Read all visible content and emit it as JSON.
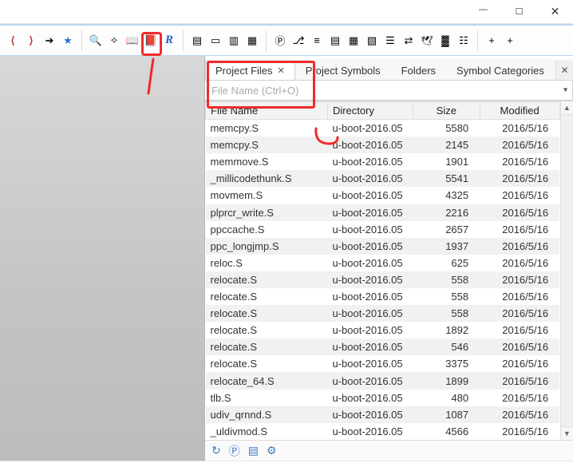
{
  "window": {
    "min": "—",
    "max": "☐",
    "close": "✕"
  },
  "tabs": {
    "project_files": "Project Files",
    "project_symbols": "Project Symbols",
    "folders": "Folders",
    "symbol_categories": "Symbol Categories"
  },
  "search": {
    "placeholder": "File Name (Ctrl+O)"
  },
  "columns": {
    "file_name": "File Name",
    "directory": "Directory",
    "size": "Size",
    "modified": "Modified"
  },
  "rows": [
    {
      "name": "memcpy.S",
      "dir": "u-boot-2016.05",
      "size": "5580",
      "mod": "2016/5/16"
    },
    {
      "name": "memcpy.S",
      "dir": "u-boot-2016.05",
      "size": "2145",
      "mod": "2016/5/16"
    },
    {
      "name": "memmove.S",
      "dir": "u-boot-2016.05",
      "size": "1901",
      "mod": "2016/5/16"
    },
    {
      "name": "_millicodethunk.S",
      "dir": "u-boot-2016.05",
      "size": "5541",
      "mod": "2016/5/16"
    },
    {
      "name": "movmem.S",
      "dir": "u-boot-2016.05",
      "size": "4325",
      "mod": "2016/5/16"
    },
    {
      "name": "plprcr_write.S",
      "dir": "u-boot-2016.05",
      "size": "2216",
      "mod": "2016/5/16"
    },
    {
      "name": "ppccache.S",
      "dir": "u-boot-2016.05",
      "size": "2657",
      "mod": "2016/5/16"
    },
    {
      "name": "ppc_longjmp.S",
      "dir": "u-boot-2016.05",
      "size": "1937",
      "mod": "2016/5/16"
    },
    {
      "name": "reloc.S",
      "dir": "u-boot-2016.05",
      "size": "625",
      "mod": "2016/5/16"
    },
    {
      "name": "relocate.S",
      "dir": "u-boot-2016.05",
      "size": "558",
      "mod": "2016/5/16"
    },
    {
      "name": "relocate.S",
      "dir": "u-boot-2016.05",
      "size": "558",
      "mod": "2016/5/16"
    },
    {
      "name": "relocate.S",
      "dir": "u-boot-2016.05",
      "size": "558",
      "mod": "2016/5/16"
    },
    {
      "name": "relocate.S",
      "dir": "u-boot-2016.05",
      "size": "1892",
      "mod": "2016/5/16"
    },
    {
      "name": "relocate.S",
      "dir": "u-boot-2016.05",
      "size": "546",
      "mod": "2016/5/16"
    },
    {
      "name": "relocate.S",
      "dir": "u-boot-2016.05",
      "size": "3375",
      "mod": "2016/5/16"
    },
    {
      "name": "relocate_64.S",
      "dir": "u-boot-2016.05",
      "size": "1899",
      "mod": "2016/5/16"
    },
    {
      "name": "tlb.S",
      "dir": "u-boot-2016.05",
      "size": "480",
      "mod": "2016/5/16"
    },
    {
      "name": "udiv_qrnnd.S",
      "dir": "u-boot-2016.05",
      "size": "1087",
      "mod": "2016/5/16"
    },
    {
      "name": "_uldivmod.S",
      "dir": "u-boot-2016.05",
      "size": "4566",
      "mod": "2016/5/16"
    }
  ],
  "toolbar_icons": [
    "brace-left-icon",
    "brace-right-icon",
    "arrow-right-box-icon",
    "star-icon",
    "sep",
    "binoculars-icon",
    "sparkle-icon",
    "open-book-icon",
    "book-up-icon",
    "r-script-icon",
    "sep",
    "layout-split-horiz-icon",
    "layout-single-icon",
    "layout-split-vert-icon",
    "layout-link-icon",
    "sep",
    "p-circle-icon",
    "branch-icon",
    "flow-icon",
    "list-icon",
    "grid1-icon",
    "grid2-icon",
    "stack-icon",
    "swap-icon",
    "bird-icon",
    "multi-icon",
    "tree-icon",
    "sep",
    "plus1-icon",
    "plus2-icon"
  ],
  "icon_glyphs": {
    "brace-left-icon": "⟨",
    "brace-right-icon": "⟩",
    "arrow-right-box-icon": "➔",
    "star-icon": "★",
    "binoculars-icon": "🔍",
    "sparkle-icon": "✧",
    "open-book-icon": "📖",
    "book-up-icon": "📕",
    "r-script-icon": "R",
    "layout-split-horiz-icon": "▤",
    "layout-single-icon": "▭",
    "layout-split-vert-icon": "▥",
    "layout-link-icon": "▦",
    "p-circle-icon": "Ⓟ",
    "branch-icon": "⎇",
    "flow-icon": "≡",
    "list-icon": "▤",
    "grid1-icon": "▦",
    "grid2-icon": "▧",
    "stack-icon": "☰",
    "swap-icon": "⇄",
    "bird-icon": "🕊",
    "multi-icon": "▓",
    "tree-icon": "☷",
    "plus1-icon": "+",
    "plus2-icon": "+"
  },
  "foot_icons": [
    "refresh-icon",
    "p-circle-icon",
    "doc-icon",
    "gear-icon"
  ],
  "foot_glyphs": {
    "refresh-icon": "↻",
    "p-circle-icon": "Ⓟ",
    "doc-icon": "▤",
    "gear-icon": "⚙"
  }
}
